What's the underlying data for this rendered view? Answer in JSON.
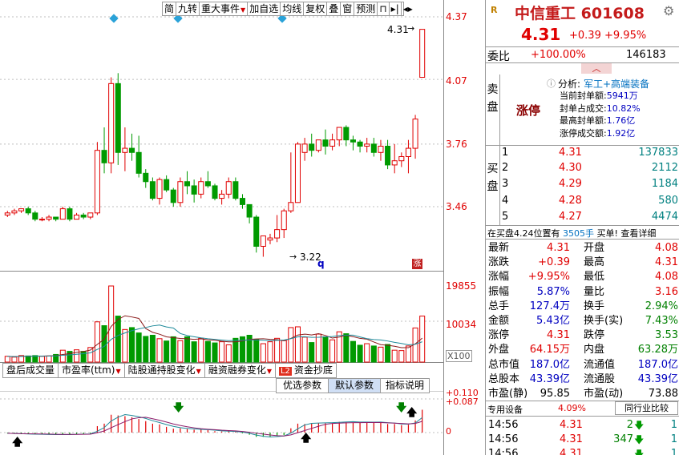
{
  "toolbar": {
    "items": [
      "简",
      "九转",
      "重大事件",
      "加自选",
      "均线",
      "复权",
      "叠",
      "窗",
      "预测"
    ]
  },
  "chart": {
    "price_ticks": [
      "4.37",
      "4.07",
      "3.76",
      "3.46"
    ],
    "vol_ticks": [
      "19855",
      "10034",
      "X100"
    ],
    "macd_ticks": [
      "0.110",
      "0.087",
      "0"
    ],
    "max_label": "4.31",
    "min_label": "3.22",
    "q_marker": "q",
    "zhang_badge": "涨",
    "bottom_tabs": [
      "盘后成交量",
      "市盈率(ttm)",
      "陆股通持股变化",
      "融资融券变化"
    ],
    "badge_l2": "L2",
    "fund_tab": "资金抄底",
    "param_tabs": [
      "优选参数",
      "默认参数",
      "指标说明"
    ]
  },
  "chart_data": {
    "type": "candlestick",
    "price_axis": [
      3.22,
      4.37
    ],
    "candles": [
      [
        3.42,
        3.44,
        3.41,
        3.43
      ],
      [
        3.43,
        3.45,
        3.42,
        3.44
      ],
      [
        3.44,
        3.45,
        3.43,
        3.45
      ],
      [
        3.45,
        3.46,
        3.42,
        3.43
      ],
      [
        3.43,
        3.44,
        3.39,
        3.4
      ],
      [
        3.4,
        3.41,
        3.39,
        3.4
      ],
      [
        3.4,
        3.42,
        3.39,
        3.41
      ],
      [
        3.41,
        3.41,
        3.39,
        3.4
      ],
      [
        3.4,
        3.46,
        3.4,
        3.45
      ],
      [
        3.45,
        3.46,
        3.39,
        3.4
      ],
      [
        3.4,
        3.43,
        3.4,
        3.42
      ],
      [
        3.42,
        3.43,
        3.4,
        3.41
      ],
      [
        3.41,
        3.43,
        3.4,
        3.43
      ],
      [
        3.43,
        3.77,
        3.42,
        3.73
      ],
      [
        3.73,
        3.84,
        3.62,
        3.67
      ],
      [
        3.67,
        4.08,
        3.62,
        4.05
      ],
      [
        4.05,
        4.1,
        3.66,
        3.72
      ],
      [
        3.72,
        3.84,
        3.63,
        3.74
      ],
      [
        3.74,
        3.81,
        3.68,
        3.72
      ],
      [
        3.72,
        3.8,
        3.6,
        3.62
      ],
      [
        3.62,
        3.64,
        3.55,
        3.58
      ],
      [
        3.58,
        3.6,
        3.49,
        3.5
      ],
      [
        3.5,
        3.6,
        3.47,
        3.59
      ],
      [
        3.59,
        3.61,
        3.53,
        3.54
      ],
      [
        3.54,
        3.55,
        3.46,
        3.48
      ],
      [
        3.48,
        3.6,
        3.46,
        3.58
      ],
      [
        3.58,
        3.63,
        3.52,
        3.56
      ],
      [
        3.56,
        3.59,
        3.48,
        3.52
      ],
      [
        3.52,
        3.6,
        3.5,
        3.58
      ],
      [
        3.58,
        3.63,
        3.55,
        3.56
      ],
      [
        3.56,
        3.57,
        3.49,
        3.5
      ],
      [
        3.5,
        3.54,
        3.47,
        3.52
      ],
      [
        3.52,
        3.6,
        3.5,
        3.58
      ],
      [
        3.58,
        3.6,
        3.49,
        3.5
      ],
      [
        3.5,
        3.52,
        3.45,
        3.47
      ],
      [
        3.47,
        3.46,
        3.38,
        3.41
      ],
      [
        3.41,
        3.42,
        3.24,
        3.27
      ],
      [
        3.27,
        3.32,
        3.22,
        3.32
      ],
      [
        3.3,
        3.33,
        3.28,
        3.31
      ],
      [
        3.31,
        3.42,
        3.29,
        3.35
      ],
      [
        3.35,
        3.45,
        3.31,
        3.44
      ],
      [
        3.44,
        3.72,
        3.43,
        3.48
      ],
      [
        3.48,
        3.77,
        3.5,
        3.76
      ],
      [
        3.72,
        3.79,
        3.68,
        3.76
      ],
      [
        3.76,
        3.81,
        3.7,
        3.73
      ],
      [
        3.73,
        3.78,
        3.72,
        3.78
      ],
      [
        3.78,
        3.83,
        3.71,
        3.75
      ],
      [
        3.75,
        3.81,
        3.73,
        3.78
      ],
      [
        3.78,
        3.84,
        3.75,
        3.84
      ],
      [
        3.84,
        3.85,
        3.75,
        3.78
      ],
      [
        3.78,
        3.8,
        3.73,
        3.77
      ],
      [
        3.77,
        3.78,
        3.72,
        3.75
      ],
      [
        3.75,
        3.79,
        3.72,
        3.76
      ],
      [
        3.76,
        3.79,
        3.7,
        3.72
      ],
      [
        3.72,
        3.78,
        3.68,
        3.75
      ],
      [
        3.75,
        3.78,
        3.64,
        3.66
      ],
      [
        3.66,
        3.76,
        3.62,
        3.68
      ],
      [
        3.68,
        3.72,
        3.65,
        3.7
      ],
      [
        3.7,
        3.78,
        3.62,
        3.74
      ],
      [
        3.74,
        3.9,
        3.69,
        3.88
      ],
      [
        4.08,
        4.31,
        4.08,
        4.31
      ]
    ],
    "volume_axis_max": 19855,
    "volumes": [
      1500,
      1300,
      1700,
      1600,
      1700,
      1500,
      1600,
      2000,
      3100,
      2800,
      3200,
      2800,
      3800,
      10500,
      9500,
      19855,
      12000,
      8500,
      9000,
      7600,
      6700,
      7000,
      6100,
      5500,
      6600,
      5600,
      6600,
      5300,
      6200,
      5400,
      5000,
      5300,
      4500,
      6200,
      6600,
      7000,
      5900,
      4800,
      5300,
      6200,
      5600,
      9000,
      9200,
      6500,
      5100,
      7300,
      6600,
      5800,
      7900,
      7400,
      5400,
      4400,
      4800,
      4200,
      3900,
      4600,
      3100,
      3000,
      4200,
      8900,
      12000
    ],
    "macd_axis": [
      -0.012,
      0.11
    ],
    "macd_bars": [
      -0.002,
      -0.003,
      -0.004,
      -0.004,
      -0.005,
      -0.005,
      -0.005,
      -0.006,
      -0.005,
      -0.005,
      -0.004,
      -0.004,
      -0.003,
      0.018,
      0.025,
      0.05,
      0.048,
      0.046,
      0.043,
      0.038,
      0.032,
      0.025,
      0.023,
      0.016,
      0.011,
      0.012,
      0.01,
      0.008,
      0.008,
      0.007,
      0.004,
      0.003,
      0.004,
      0.002,
      -0.002,
      -0.006,
      -0.012,
      -0.012,
      -0.011,
      -0.009,
      -0.007,
      0.012,
      0.025,
      0.024,
      0.025,
      0.027,
      0.026,
      0.026,
      0.03,
      0.029,
      0.028,
      0.027,
      0.029,
      0.027,
      0.028,
      0.024,
      0.024,
      0.021,
      0.022,
      0.034,
      0.064
    ]
  },
  "quote": {
    "flag": "R",
    "name": "中信重工",
    "code": "601608",
    "price": "4.31",
    "change": "+0.39",
    "pct": "+9.95%",
    "weibi_label": "委比",
    "weibi_pct": "+100.00%",
    "weibi_vol": "146183",
    "sell_label": "卖盘",
    "zhangting": "涨停",
    "analysis_label": "分析:",
    "analysis_value": "军工+高端装备",
    "stats": [
      {
        "k": "当前封单额:",
        "v": "5941万"
      },
      {
        "k": "封单占成交:",
        "v": "10.82%"
      },
      {
        "k": "最高封单额:",
        "v": "1.76亿"
      },
      {
        "k": "涨停成交额:",
        "v": "1.92亿"
      }
    ],
    "buy_label": "买盘",
    "bids": [
      {
        "i": "1",
        "p": "4.31",
        "q": "137833"
      },
      {
        "i": "2",
        "p": "4.30",
        "q": "2112"
      },
      {
        "i": "3",
        "p": "4.29",
        "q": "1184"
      },
      {
        "i": "4",
        "p": "4.28",
        "q": "580"
      },
      {
        "i": "5",
        "p": "4.27",
        "q": "4474"
      }
    ],
    "notice_left": "在买盘4.24位置有",
    "notice_mid": "3505手",
    "notice_right": "买单! 查看详细",
    "fields": [
      {
        "k": "最新",
        "v": "4.31",
        "vc": "red",
        "k2": "开盘",
        "v2": "4.08",
        "v2c": "red"
      },
      {
        "k": "涨跌",
        "v": "+0.39",
        "vc": "red",
        "k2": "最高",
        "v2": "4.31",
        "v2c": "red"
      },
      {
        "k": "涨幅",
        "v": "+9.95%",
        "vc": "red",
        "k2": "最低",
        "v2": "4.08",
        "v2c": "red"
      },
      {
        "k": "振幅",
        "v": "5.87%",
        "vc": "blu",
        "k2": "量比",
        "v2": "3.16",
        "v2c": "red"
      },
      {
        "k": "总手",
        "v": "127.4万",
        "vc": "blu",
        "k2": "换手",
        "v2": "2.94%",
        "v2c": "grn"
      },
      {
        "k": "金额",
        "v": "5.43亿",
        "vc": "blu",
        "k2": "换手(实)",
        "v2": "7.43%",
        "v2c": "grn"
      },
      {
        "k": "涨停",
        "v": "4.31",
        "vc": "red",
        "k2": "跌停",
        "v2": "3.53",
        "v2c": "grn"
      },
      {
        "k": "外盘",
        "v": "64.15万",
        "vc": "red",
        "k2": "内盘",
        "v2": "63.28万",
        "v2c": "grn"
      },
      {
        "k": "总市值",
        "v": "187.0亿",
        "vc": "blu",
        "k2": "流通值",
        "v2": "187.0亿",
        "v2c": "blu"
      },
      {
        "k": "总股本",
        "v": "43.39亿",
        "vc": "blu",
        "k2": "流通股",
        "v2": "43.39亿",
        "v2c": "blu"
      },
      {
        "k": "市盈(静)",
        "v": "95.85",
        "vc": "blk",
        "k2": "市盈(动)",
        "v2": "73.88",
        "v2c": "blk"
      }
    ],
    "tabs": [
      "专用设备",
      "4.09%",
      "同行业比较"
    ],
    "ticks": [
      {
        "t": "14:56",
        "p": "4.31",
        "q": "2",
        "n": "1"
      },
      {
        "t": "14:56",
        "p": "4.31",
        "q": "347",
        "n": "1"
      },
      {
        "t": "14:56",
        "p": "4.31",
        "q": "",
        "n": "1"
      }
    ]
  },
  "colors": {
    "up": "#e00000",
    "down": "#009a00",
    "accent": "#c41a1a",
    "grid": "#bfbfbf"
  }
}
